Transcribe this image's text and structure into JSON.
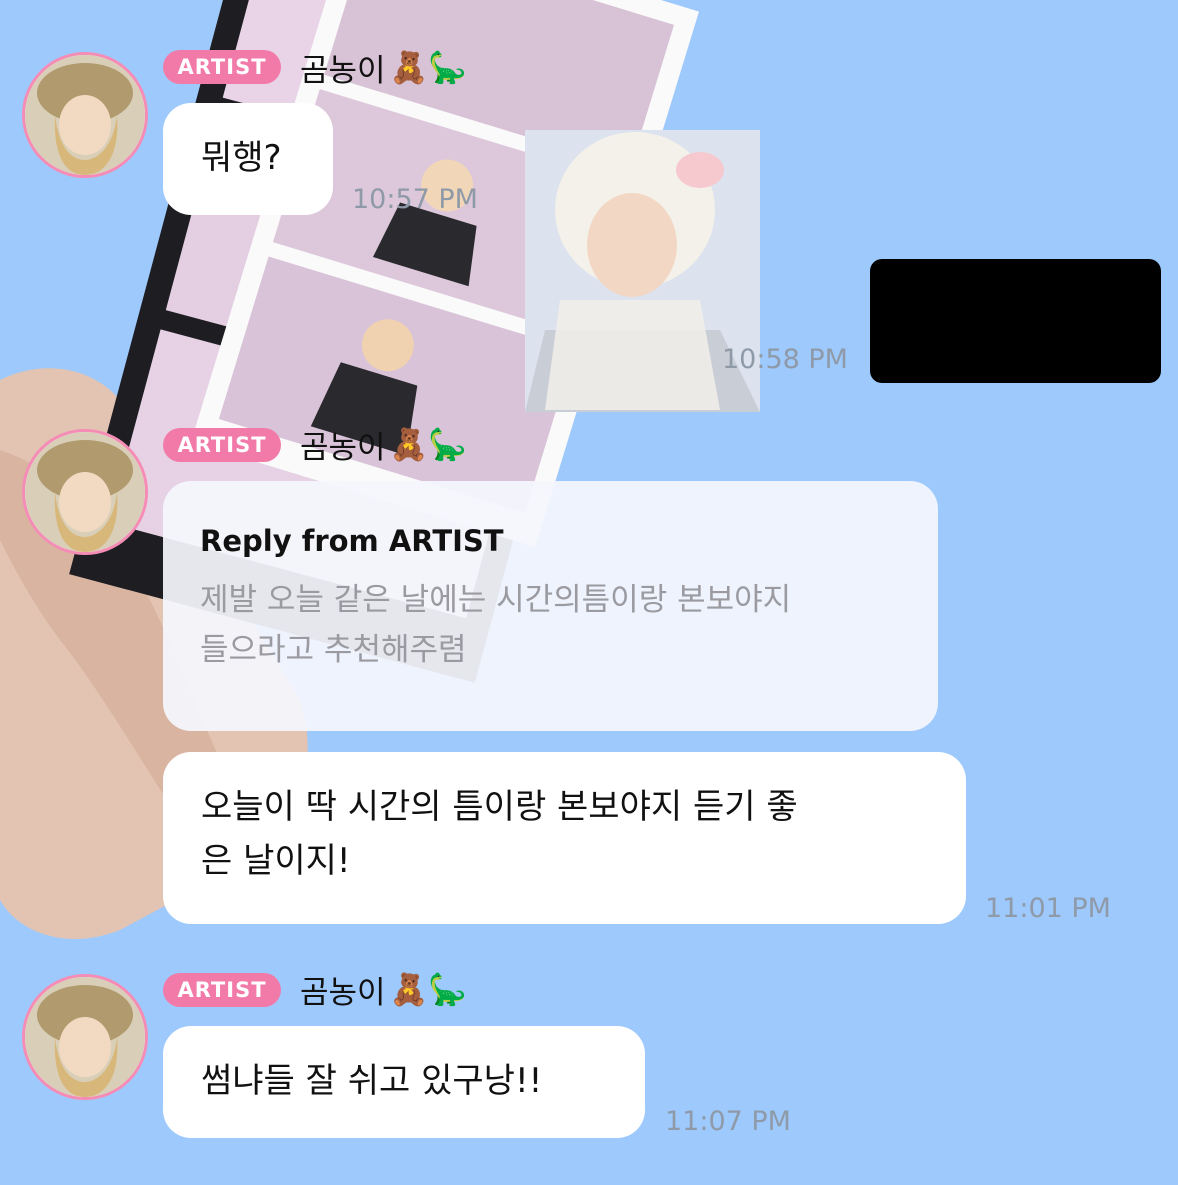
{
  "colors": {
    "background": "#9ec9fc",
    "badge": "#f27aa9",
    "avatar_ring": "#f58cb6",
    "bubble": "#ffffff",
    "reply_bubble": "#f4f6fd",
    "timestamp": "#8f9aa8",
    "reply_text": "#9a9aa0"
  },
  "messages": [
    {
      "badge": "ARTIST",
      "sender": "곰농이",
      "emoji": "🧸🦕",
      "text": "뭐행?",
      "time": "10:57 PM"
    },
    {
      "outgoing": true,
      "redacted": true,
      "time": "10:58 PM"
    },
    {
      "badge": "ARTIST",
      "sender": "곰농이",
      "emoji": "🧸🦕",
      "reply": {
        "title": "Reply from ARTIST",
        "quoted_line1": "제발 오늘 같은 날에는 시간의틈이랑 본보야지",
        "quoted_line2": "들으라고 추천해주렴"
      },
      "text_line1": "오늘이 딱 시간의 틈이랑 본보야지 듣기 좋",
      "text_line2": "은 날이지!",
      "time": "11:01 PM"
    },
    {
      "badge": "ARTIST",
      "sender": "곰농이",
      "emoji": "🧸🦕",
      "text": "썸냐들 잘 쉬고 있구낭!!",
      "time": "11:07 PM"
    }
  ]
}
